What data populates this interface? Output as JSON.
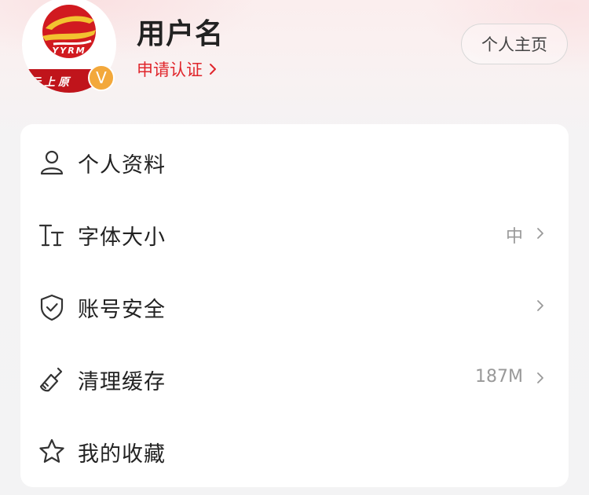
{
  "header": {
    "avatar_logo_text": "YYRM",
    "avatar_caption": "云上原",
    "verified_badge": "V",
    "username": "用户名",
    "apply_verify_label": "申请认证",
    "homepage_button_label": "个人主页"
  },
  "menu": {
    "items": [
      {
        "label": "个人资料",
        "icon": "user-icon",
        "value": ""
      },
      {
        "label": "字体大小",
        "icon": "font-size-icon",
        "value": "中"
      },
      {
        "label": "账号安全",
        "icon": "shield-check-icon",
        "value": ""
      },
      {
        "label": "清理缓存",
        "icon": "broom-icon",
        "value": "187M"
      },
      {
        "label": "我的收藏",
        "icon": "star-icon",
        "value": ""
      }
    ]
  },
  "colors": {
    "brand_red": "#e0262c",
    "logo_red": "#c0141b",
    "badge_orange": "#f3a83b",
    "text_primary": "#222222",
    "text_secondary": "#999999"
  }
}
